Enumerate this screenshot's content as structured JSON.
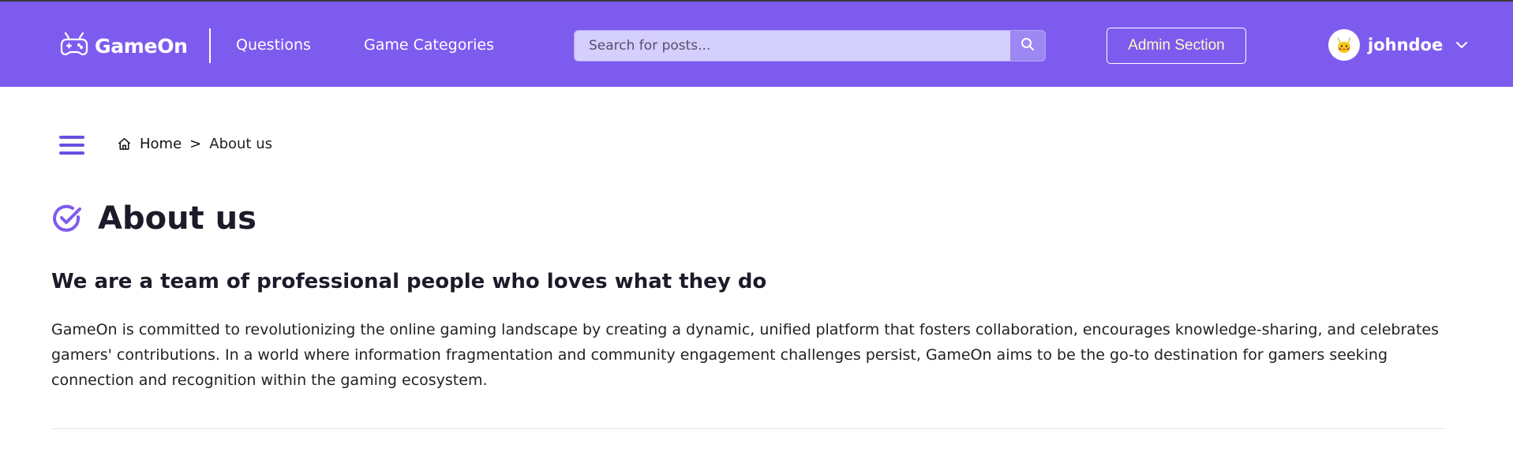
{
  "header": {
    "logo_text": "GameOn",
    "nav": {
      "questions": "Questions",
      "game_categories": "Game Categories"
    },
    "search": {
      "placeholder": "Search for posts..."
    },
    "admin_label": "Admin Section",
    "username": "johndoe"
  },
  "breadcrumb": {
    "home": "Home",
    "separator": ">",
    "current": "About us"
  },
  "page": {
    "title": "About us",
    "subheading": "We are a team of professional people who loves what they do",
    "body": "GameOn is committed to revolutionizing the online gaming landscape by creating a dynamic, unified platform that fosters collaboration, encourages knowledge-sharing, and celebrates gamers' contributions. In a world where information fragmentation and community engagement challenges persist, GameOn aims to be the go-to destination for gamers seeking connection and recognition within the gaming ecosystem."
  },
  "colors": {
    "header_bg": "#7e5bef",
    "accent": "#6a4fe0",
    "admin_text": "#fff9c7"
  },
  "icons": {
    "logo": "gamepad-icon",
    "search": "search-icon",
    "avatar": "pikachu-avatar",
    "chevron": "chevron-down-icon",
    "menu": "hamburger-menu-icon",
    "home": "home-icon",
    "title": "check-circle-icon"
  }
}
